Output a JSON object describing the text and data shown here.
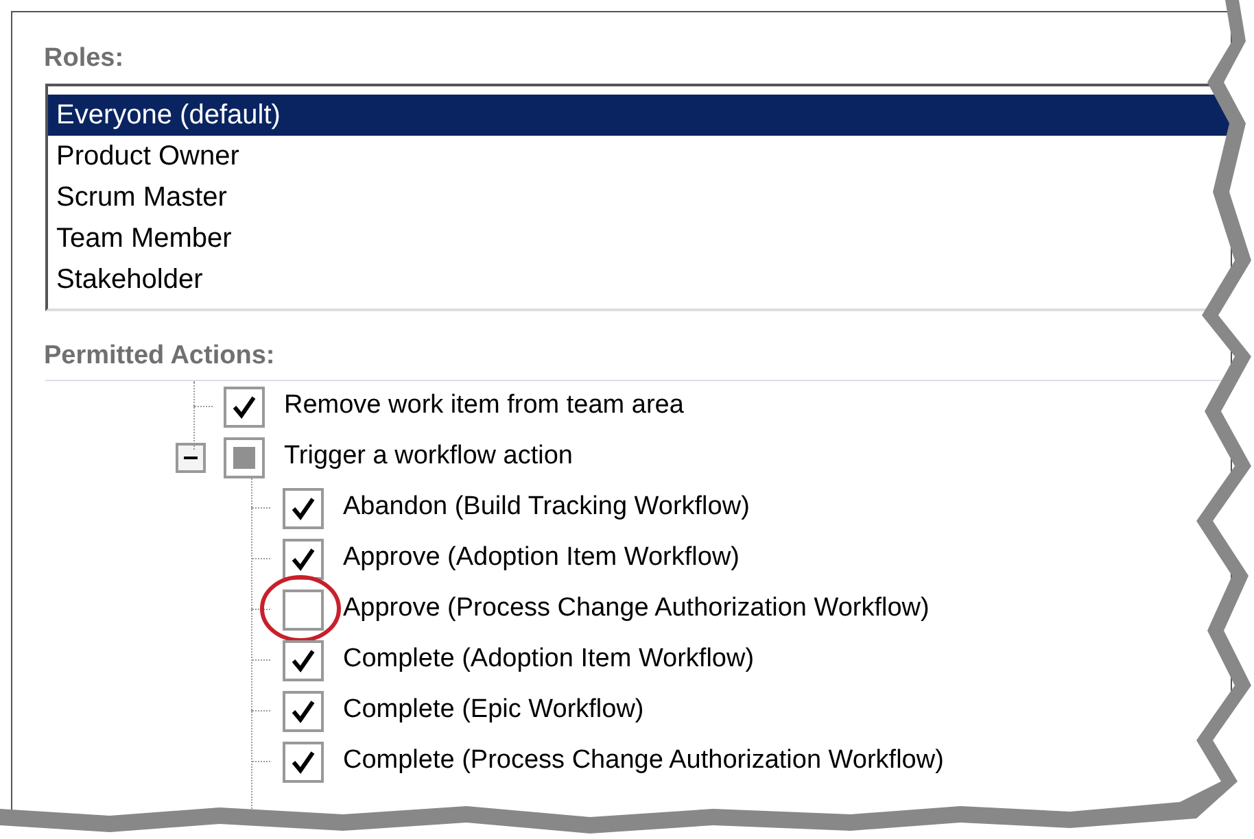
{
  "roles": {
    "label": "Roles:",
    "items": [
      {
        "label": "Everyone (default)",
        "selected": true
      },
      {
        "label": "Product Owner",
        "selected": false
      },
      {
        "label": "Scrum Master",
        "selected": false
      },
      {
        "label": "Team Member",
        "selected": false
      },
      {
        "label": "Stakeholder",
        "selected": false
      }
    ]
  },
  "permitted_actions": {
    "label": "Permitted Actions:",
    "tree": [
      {
        "label": "Remove work item from team area",
        "checked": true,
        "indeterminate": false
      },
      {
        "label": "Trigger a workflow action",
        "checked": false,
        "indeterminate": true,
        "expanded": true,
        "children": [
          {
            "label": "Abandon (Build Tracking Workflow)",
            "checked": true,
            "indeterminate": false,
            "highlighted": false
          },
          {
            "label": "Approve (Adoption Item Workflow)",
            "checked": true,
            "indeterminate": false,
            "highlighted": false
          },
          {
            "label": "Approve (Process Change Authorization Workflow)",
            "checked": false,
            "indeterminate": false,
            "highlighted": true
          },
          {
            "label": "Complete (Adoption Item Workflow)",
            "checked": true,
            "indeterminate": false,
            "highlighted": false
          },
          {
            "label": "Complete (Epic Workflow)",
            "checked": true,
            "indeterminate": false,
            "highlighted": false
          },
          {
            "label": "Complete (Process Change Authorization Workflow)",
            "checked": true,
            "indeterminate": false,
            "highlighted": false
          }
        ]
      }
    ]
  }
}
